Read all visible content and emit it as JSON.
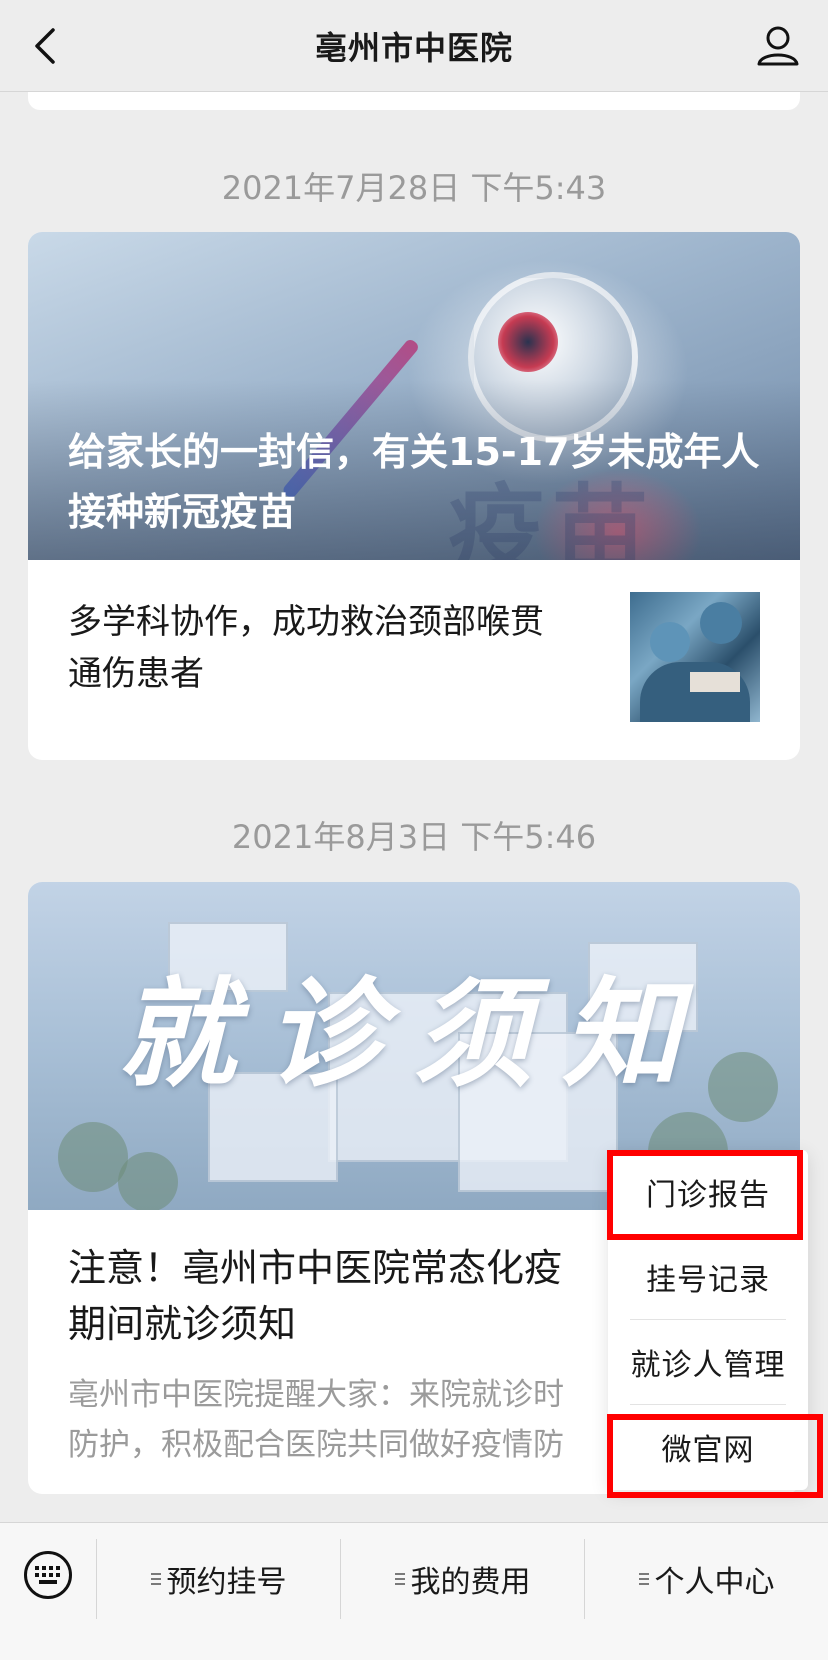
{
  "header": {
    "title": "亳州市中医院"
  },
  "feed": [
    {
      "timestamp": "2021年7月28日 下午5:43",
      "main_title": "给家长的一封信，有关15-17岁未成年人接种新冠疫苗",
      "cover_bg_text": "疫苗",
      "sub_title": "多学科协作，成功救治颈部喉贯通伤患者"
    },
    {
      "timestamp": "2021年8月3日 下午5:46",
      "cover_text": "就诊须知",
      "title": "注意！亳州市中医院常态化疫情防控期间就诊须知",
      "title_visible": "注意！亳州市中医院常态化疫\n期间就诊须知",
      "desc_visible": "亳州市中医院提醒大家：来院就诊时\n防护，积极配合医院共同做好疫情防"
    }
  ],
  "popup_menu": {
    "items": [
      "门诊报告",
      "挂号记录",
      "就诊人管理",
      "微官网"
    ],
    "highlighted": [
      "门诊报告",
      "微官网"
    ],
    "highlight_color": "#ff0000"
  },
  "bottom_menu": {
    "items": [
      "预约挂号",
      "我的费用",
      "个人中心"
    ]
  },
  "icons": {
    "back": "chevron-left-icon",
    "user": "user-icon",
    "keyboard": "keyboard-icon",
    "menu_lines": "menu-lines-icon"
  }
}
